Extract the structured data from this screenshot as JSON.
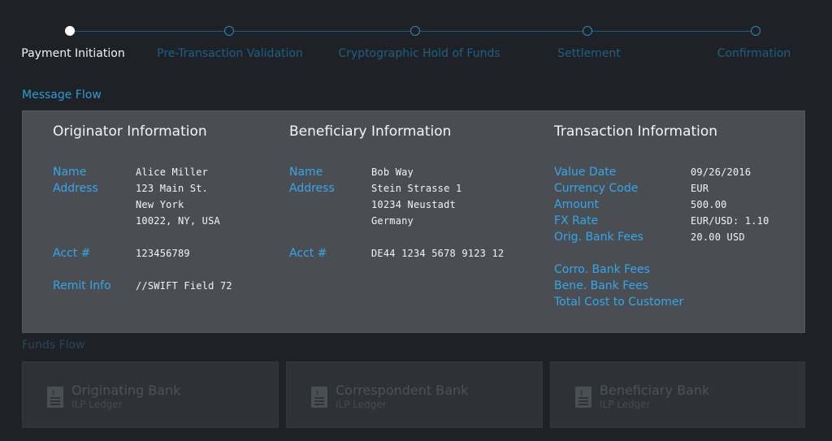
{
  "steps": [
    {
      "label": "Payment Initiation",
      "active": true
    },
    {
      "label": "Pre-Transaction Validation",
      "active": false
    },
    {
      "label": "Cryptographic Hold of Funds",
      "active": false
    },
    {
      "label": "Settlement",
      "active": false
    },
    {
      "label": "Confirmation",
      "active": false
    }
  ],
  "message_flow": {
    "title": "Message Flow",
    "originator": {
      "heading": "Originator Information",
      "name_label": "Name",
      "address_label": "Address",
      "acct_label": "Acct #",
      "remit_label": "Remit Info",
      "name": "Alice Miller",
      "address": [
        "123 Main St.",
        "New York",
        "10022, NY, USA"
      ],
      "acct": "123456789",
      "remit": "//SWIFT Field 72"
    },
    "beneficiary": {
      "heading": "Beneficiary Information",
      "name_label": "Name",
      "address_label": "Address",
      "acct_label": "Acct #",
      "name": "Bob Way",
      "address": [
        "Stein Strasse 1",
        "10234 Neustadt",
        "Germany"
      ],
      "acct": "DE44 1234 5678 9123 12"
    },
    "transaction": {
      "heading": "Transaction Information",
      "value_date_label": "Value Date",
      "currency_code_label": "Currency Code",
      "amount_label": "Amount",
      "fx_rate_label": "FX Rate",
      "orig_fees_label": "Orig. Bank Fees",
      "corro_fees_label": "Corro. Bank Fees",
      "bene_fees_label": "Bene. Bank Fees",
      "total_cost_label": "Total Cost to Customer",
      "value_date": "09/26/2016",
      "currency_code": "EUR",
      "amount": "500.00",
      "fx_rate": "EUR/USD: 1.10",
      "orig_fees": "20.00 USD"
    }
  },
  "funds_flow": {
    "title": "Funds Flow",
    "banks": [
      {
        "name": "Originating Bank",
        "sub": "ILP Ledger",
        "icon": "ledger-icon"
      },
      {
        "name": "Correspondent Bank",
        "sub": "ILP Ledger",
        "icon": "ledger-icon"
      },
      {
        "name": "Beneficiary Bank",
        "sub": "ILP Ledger",
        "icon": "ledger-icon"
      }
    ]
  },
  "colors": {
    "accent": "#34a7ea",
    "panel": "#4a4e53",
    "background": "#1e2227"
  }
}
